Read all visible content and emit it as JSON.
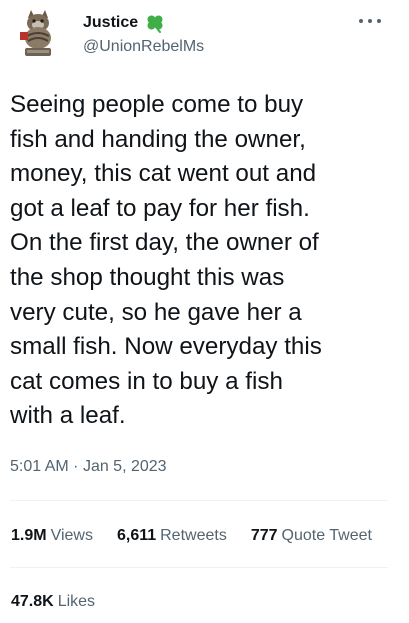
{
  "author": {
    "display_name": "Justice",
    "badge_icon": "four-leaf-clover-icon",
    "handle": "@UnionRebelMs",
    "avatar_icon": "cat-avatar"
  },
  "tweet": {
    "text": "Seeing people come to buy\nfish and handing the owner,\nmoney, this cat went out and\ngot a leaf to pay for her fish.\nOn the first day, the owner of\nthe shop thought this was\nvery cute, so he gave her a\nsmall fish. Now everyday this\ncat comes in to buy a fish\nwith a leaf.",
    "time": "5:01 AM",
    "separator": "·",
    "date": "Jan 5, 2023"
  },
  "stats": {
    "views": {
      "value": "1.9M",
      "label": "Views"
    },
    "retweets": {
      "value": "6,611",
      "label": "Retweets"
    },
    "quote_tweets": {
      "value": "777",
      "label": "Quote Tweet"
    },
    "likes": {
      "value": "47.8K",
      "label": "Likes"
    }
  },
  "colors": {
    "text_primary": "#0f1419",
    "text_secondary": "#536471",
    "divider": "#eff3f4",
    "clover_green": "#3fae49"
  }
}
